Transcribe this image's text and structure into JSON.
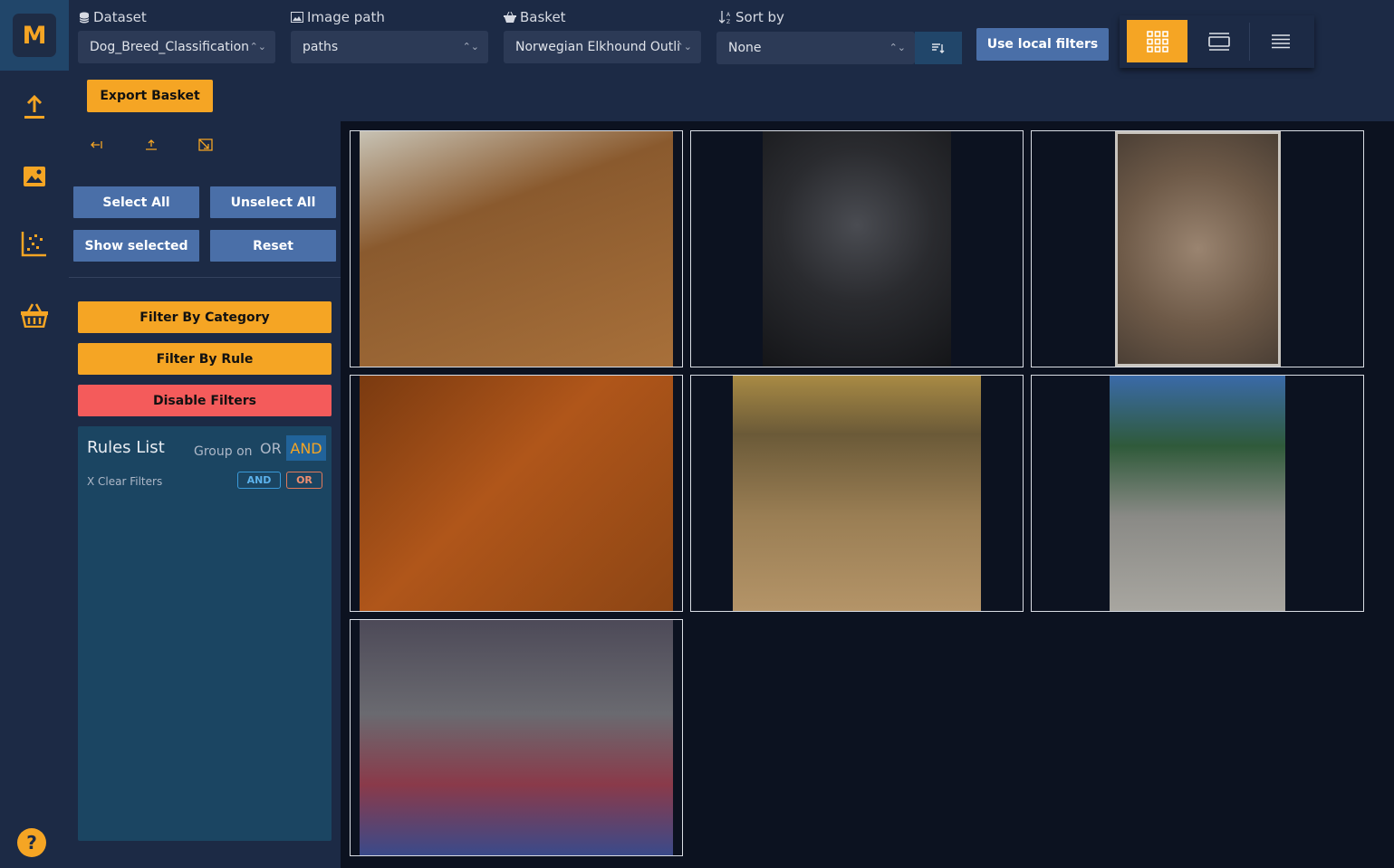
{
  "app": {
    "logo_letter": "M"
  },
  "nav": {
    "items": [
      {
        "name": "upload-icon"
      },
      {
        "name": "image-icon"
      },
      {
        "name": "scatter-plot-icon"
      },
      {
        "name": "basket-icon"
      }
    ],
    "help_label": "?"
  },
  "toolbar": {
    "dataset": {
      "label": "Dataset",
      "value": "Dog_Breed_Classification"
    },
    "image_path": {
      "label": "Image path",
      "value": "paths"
    },
    "basket": {
      "label": "Basket",
      "value": "Norwegian Elkhound Outli"
    },
    "sort_by": {
      "label": "Sort by",
      "value": "None"
    },
    "use_local_filters_label": "Use local filters",
    "export_basket_label": "Export Basket",
    "active_view": "grid"
  },
  "panel": {
    "select_all_label": "Select All",
    "unselect_all_label": "Unselect All",
    "show_selected_label": "Show selected",
    "reset_label": "Reset",
    "filter_by_category_label": "Filter By Category",
    "filter_by_rule_label": "Filter By Rule",
    "disable_filters_label": "Disable Filters",
    "rules": {
      "title": "Rules List",
      "group_on_label": "Group on",
      "or_label": "OR",
      "and_label": "AND",
      "clear_filters_label": "X Clear Filters",
      "chip_and": "AND",
      "chip_or": "OR"
    }
  },
  "images": [
    {
      "desc": "",
      "bg": "#8a5a2e"
    },
    {
      "desc": "",
      "bg": "#1c1e22"
    },
    {
      "desc": "",
      "bg": "#6e5a48"
    },
    {
      "desc": "",
      "bg": "#b0561a"
    },
    {
      "desc": "",
      "bg": "#9a7e54"
    },
    {
      "desc": "",
      "bg": "#6a8a7a"
    },
    {
      "desc": "",
      "bg": "#4d4a58"
    }
  ],
  "colors": {
    "accent": "#f5a524",
    "primary_button": "#4a6fa8",
    "danger": "#f45b5b",
    "panel_bg": "#1c2a45",
    "content_bg": "#0c1220"
  }
}
